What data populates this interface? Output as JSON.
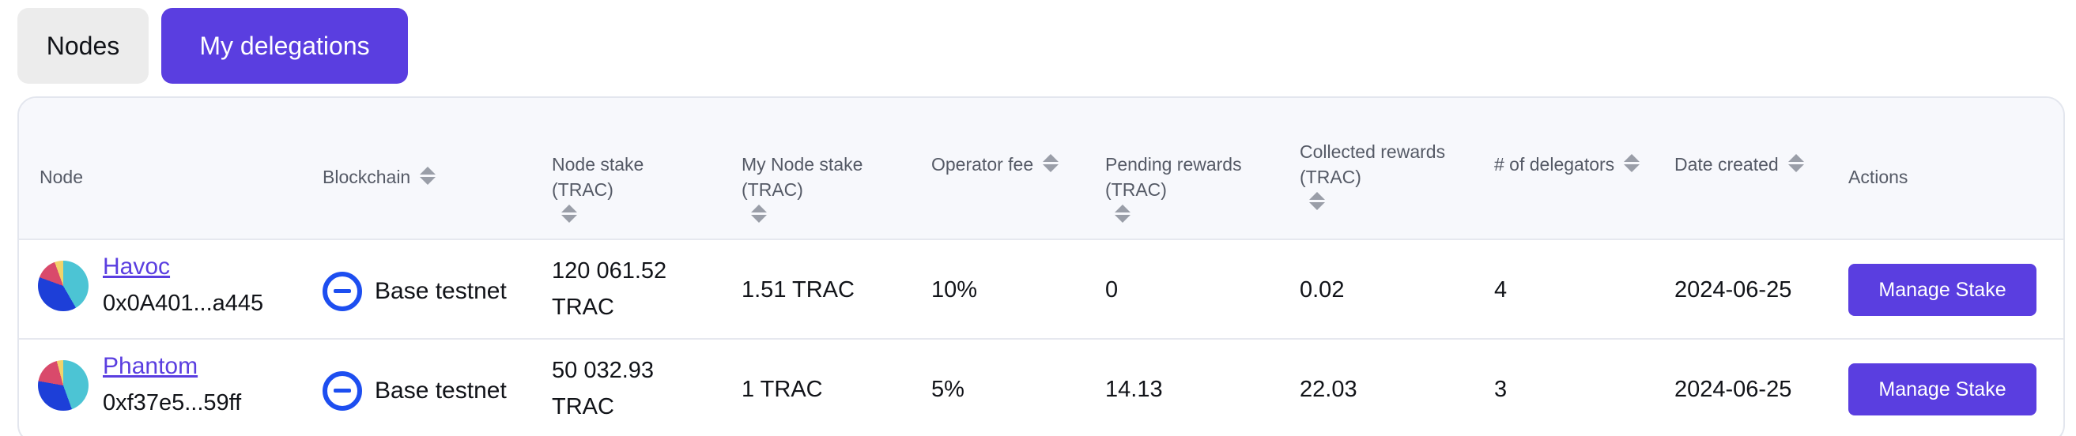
{
  "tabs": [
    {
      "label": "Nodes"
    },
    {
      "label": "My delegations"
    }
  ],
  "table": {
    "headers": {
      "node": "Node",
      "blockchain": "Blockchain",
      "node_stake": "Node stake (TRAC)",
      "my_node_stake": "My Node stake (TRAC)",
      "operator_fee": "Operator fee",
      "pending_rewards": "Pending rewards (TRAC)",
      "collected_rewards": "Collected rewards (TRAC)",
      "delegators": "# of delegators",
      "date_created": "Date created",
      "actions": "Actions"
    },
    "rows": [
      {
        "node_name": "Havoc",
        "node_address": "0x0A401...a445",
        "blockchain": "Base testnet",
        "node_stake_value": "120 061.52",
        "node_stake_unit": "TRAC",
        "my_node_stake": "1.51 TRAC",
        "operator_fee": "10%",
        "pending_rewards": "0",
        "collected_rewards": "0.02",
        "delegators": "4",
        "date_created": "2024-06-25",
        "action_label": "Manage Stake"
      },
      {
        "node_name": "Phantom",
        "node_address": "0xf37e5...59ff",
        "blockchain": "Base testnet",
        "node_stake_value": "50 032.93",
        "node_stake_unit": "TRAC",
        "my_node_stake": "1 TRAC",
        "operator_fee": "5%",
        "pending_rewards": "14.13",
        "collected_rewards": "22.03",
        "delegators": "3",
        "date_created": "2024-06-25",
        "action_label": "Manage Stake"
      }
    ]
  },
  "icons": {
    "node_avatar": "pie-chart-avatar-icon",
    "blockchain": "base-chain-icon",
    "sort": "sort-arrows-icon"
  },
  "colors": {
    "accent": "#5a3ee0",
    "chain_blue": "#1d4ef0"
  }
}
